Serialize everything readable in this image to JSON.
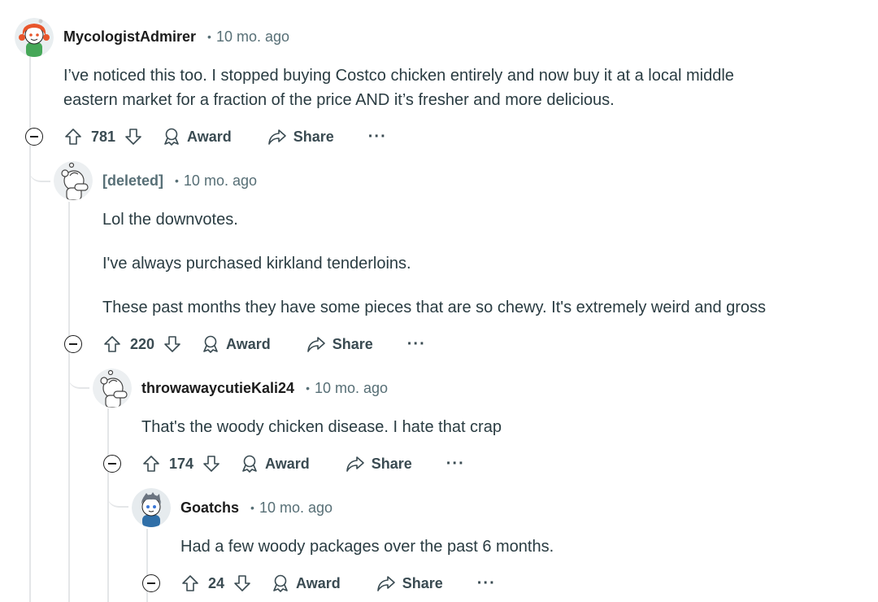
{
  "comments": [
    {
      "username": "MycologistAdmirer",
      "time": "10 mo. ago",
      "body": [
        "I’ve noticed this too. I stopped buying Costco chicken entirely and now buy it at a local middle",
        "eastern market for a fraction of the price AND it’s fresher and more delicious."
      ],
      "score": "781",
      "avatar": "orange-haired-snoo-avatar"
    },
    {
      "username": "[deleted]",
      "time": "10 mo. ago",
      "body": [
        "Lol the downvotes.",
        "I've always purchased kirkland tenderloins.",
        "These past months they have some pieces that are so chewy. It's extremely weird and gross"
      ],
      "score": "220",
      "avatar": "default-snoo-avatar"
    },
    {
      "username": "throwawaycutieKali24",
      "time": "10 mo. ago",
      "body": [
        "That's the woody chicken disease. I hate that crap"
      ],
      "score": "174",
      "avatar": "default-snoo-avatar"
    },
    {
      "username": "Goatchs",
      "time": "10 mo. ago",
      "body": [
        "Had a few woody packages over the past 6 months."
      ],
      "score": "24",
      "avatar": "gray-haired-snoo-avatar"
    }
  ],
  "labels": {
    "award": "Award",
    "share": "Share",
    "more": "···",
    "dot": "•"
  },
  "colors": {
    "text": "#1c1c1c",
    "muted": "#576f76",
    "thread": "#e4e6e8"
  }
}
